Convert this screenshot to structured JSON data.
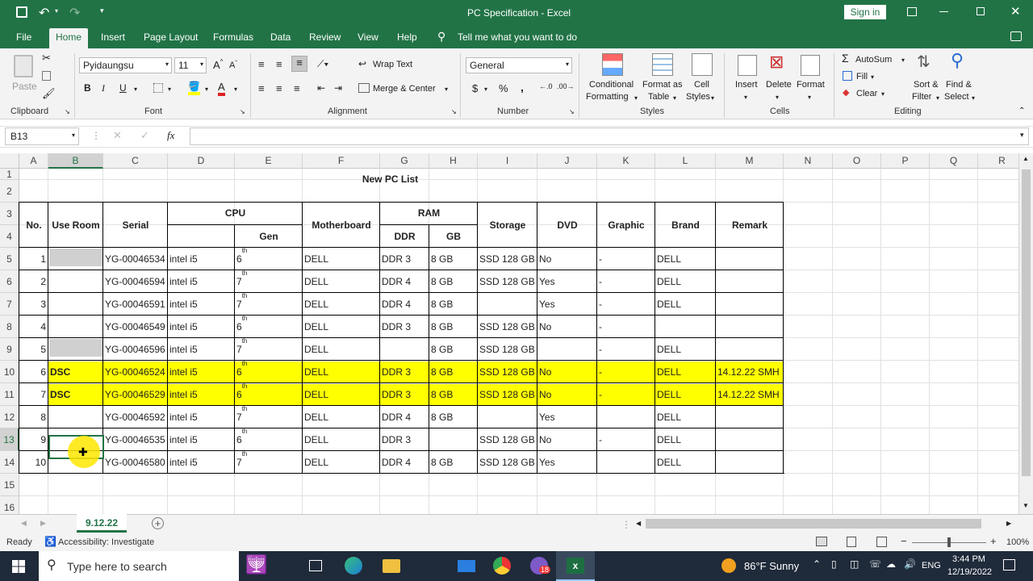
{
  "titlebar": {
    "title": "PC Specification  -  Excel",
    "signin": "Sign in"
  },
  "menu": [
    "File",
    "Home",
    "Insert",
    "Page Layout",
    "Formulas",
    "Data",
    "Review",
    "View",
    "Help"
  ],
  "tellme": "Tell me what you want to do",
  "ribbon": {
    "paste": "Paste",
    "clipboard": "Clipboard",
    "font_name": "Pyidaungsu",
    "font_size": "11",
    "font": "Font",
    "bold": "B",
    "italic": "I",
    "underline": "U",
    "wrap_text": "Wrap Text",
    "merge_center": "Merge & Center",
    "alignment": "Alignment",
    "number_format": "General",
    "number": "Number",
    "currency": "$",
    "percent": "%",
    "comma": ",",
    "cond_fmt_1": "Conditional",
    "cond_fmt_2": "Formatting",
    "fmt_table_1": "Format as",
    "fmt_table_2": "Table",
    "cell_styles_1": "Cell",
    "cell_styles_2": "Styles",
    "styles": "Styles",
    "insert": "Insert",
    "delete": "Delete",
    "format": "Format",
    "cells": "Cells",
    "autosum": "AutoSum",
    "fill": "Fill",
    "clear": "Clear",
    "sort_1": "Sort &",
    "sort_2": "Filter",
    "find_1": "Find &",
    "find_2": "Select",
    "editing": "Editing"
  },
  "namebox": "B13",
  "fx": "fx",
  "columns": [
    "A",
    "B",
    "C",
    "D",
    "E",
    "F",
    "G",
    "H",
    "I",
    "J",
    "K",
    "L",
    "M",
    "N",
    "O",
    "P",
    "Q",
    "R"
  ],
  "rows": [
    "1",
    "2",
    "3",
    "4",
    "5",
    "6",
    "7",
    "8",
    "9",
    "10",
    "11",
    "12",
    "13",
    "14",
    "15",
    "16"
  ],
  "table": {
    "title": "New PC List",
    "h_no": "No.",
    "h_use_room": "Use Room",
    "h_serial": "Serial",
    "h_cpu": "CPU",
    "h_gen": "Gen",
    "h_motherboard": "Motherboard",
    "h_ram": "RAM",
    "h_ddr": "DDR",
    "h_gb": "GB",
    "h_storage": "Storage",
    "h_dvd": "DVD",
    "h_graphic": "Graphic",
    "h_brand": "Brand",
    "h_remark": "Remark",
    "rows": [
      {
        "no": "1",
        "room": "",
        "serial": "YG-00046534",
        "cpu": "intel i5",
        "gen": "6",
        "sup": "th",
        "mb": "DELL",
        "ddr": "DDR 3",
        "gb": "8 GB",
        "storage": "SSD 128 GB",
        "dvd": "No",
        "graphic": "-",
        "brand": "DELL",
        "remark": ""
      },
      {
        "no": "2",
        "room": "",
        "serial": "YG-00046594",
        "cpu": "intel i5",
        "gen": "7",
        "sup": "th",
        "mb": "DELL",
        "ddr": "DDR 4",
        "gb": "8 GB",
        "storage": "SSD 128 GB",
        "dvd": "Yes",
        "graphic": "-",
        "brand": "DELL",
        "remark": ""
      },
      {
        "no": "3",
        "room": "",
        "serial": "YG-00046591",
        "cpu": "intel i5",
        "gen": "7",
        "sup": "th",
        "mb": "DELL",
        "ddr": "DDR 4",
        "gb": "8 GB",
        "storage": "",
        "dvd": "Yes",
        "graphic": "-",
        "brand": "DELL",
        "remark": ""
      },
      {
        "no": "4",
        "room": "",
        "serial": "YG-00046549",
        "cpu": "intel i5",
        "gen": "6",
        "sup": "th",
        "mb": "DELL",
        "ddr": "DDR 3",
        "gb": "8 GB",
        "storage": "SSD 128 GB",
        "dvd": "No",
        "graphic": "-",
        "brand": "",
        "remark": ""
      },
      {
        "no": "5",
        "room": "",
        "serial": "YG-00046596",
        "cpu": "intel i5",
        "gen": "7",
        "sup": "th",
        "mb": "DELL",
        "ddr": "",
        "gb": "8 GB",
        "storage": "SSD 128 GB",
        "dvd": "",
        "graphic": "-",
        "brand": "DELL",
        "remark": ""
      },
      {
        "no": "6",
        "room": "DSC",
        "serial": "YG-00046524",
        "cpu": "intel i5",
        "gen": "6",
        "sup": "th",
        "mb": "DELL",
        "ddr": "DDR 3",
        "gb": "8 GB",
        "storage": "SSD 128 GB",
        "dvd": "No",
        "graphic": "-",
        "brand": "DELL",
        "remark": "14.12.22 SMH"
      },
      {
        "no": "7",
        "room": "DSC",
        "serial": "YG-00046529",
        "cpu": "intel i5",
        "gen": "6",
        "sup": "th",
        "mb": "DELL",
        "ddr": "DDR 3",
        "gb": "8 GB",
        "storage": "SSD 128 GB",
        "dvd": "No",
        "graphic": "-",
        "brand": "DELL",
        "remark": "14.12.22 SMH"
      },
      {
        "no": "8",
        "room": "",
        "serial": "YG-00046592",
        "cpu": "intel i5",
        "gen": "7",
        "sup": "th",
        "mb": "DELL",
        "ddr": "DDR 4",
        "gb": "8 GB",
        "storage": "",
        "dvd": "Yes",
        "graphic": "",
        "brand": "DELL",
        "remark": ""
      },
      {
        "no": "9",
        "room": "",
        "serial": "YG-00046535",
        "cpu": "intel i5",
        "gen": "6",
        "sup": "th",
        "mb": "DELL",
        "ddr": "DDR 3",
        "gb": "",
        "storage": "SSD 128 GB",
        "dvd": "No",
        "graphic": "-",
        "brand": "DELL",
        "remark": ""
      },
      {
        "no": "10",
        "room": "",
        "serial": "YG-00046580",
        "cpu": "intel i5",
        "gen": "7",
        "sup": "th",
        "mb": "DELL",
        "ddr": "DDR 4",
        "gb": "8 GB",
        "storage": "SSD 128 GB",
        "dvd": "Yes",
        "graphic": "",
        "brand": "DELL",
        "remark": ""
      }
    ]
  },
  "sheet_tab": "9.12.22",
  "status": {
    "ready": "Ready",
    "accessibility": "Accessibility: Investigate",
    "zoom": "100%"
  },
  "taskbar": {
    "search": "Type here to search",
    "weather": "86°F  Sunny",
    "lang": "ENG",
    "time": "3:44 PM",
    "date": "12/19/2022",
    "badge": "18"
  },
  "colors": {
    "excel_green": "#217346",
    "highlight": "#ffff00",
    "gray_fill": "#d0d0d0"
  }
}
